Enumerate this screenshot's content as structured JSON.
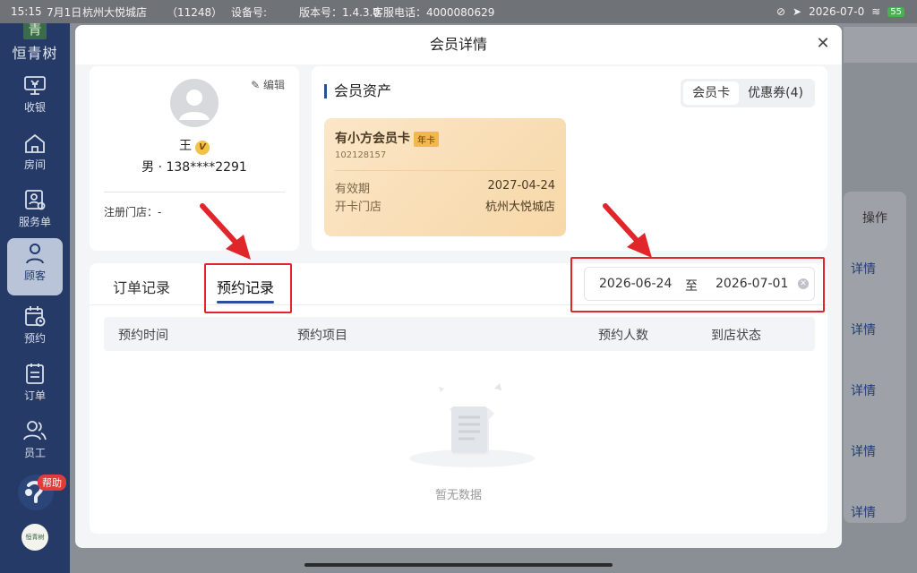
{
  "status_bar": {
    "time": "15:15",
    "date": "7月1日",
    "store": "杭州大悦城店",
    "store_id": "（11248）",
    "device": "设备号:",
    "version": "版本号：1.4.3.0",
    "phone": "客服电话：4000080629",
    "datetime_right": "2026-07-0",
    "battery": "55"
  },
  "sidebar": {
    "logo_mark": "青",
    "logo_name": "恒青树",
    "items": [
      {
        "label": "收银",
        "icon": "cashier-icon"
      },
      {
        "label": "房间",
        "icon": "home-icon"
      },
      {
        "label": "服务单",
        "icon": "service-order-icon"
      },
      {
        "label": "顾客",
        "icon": "customer-icon"
      },
      {
        "label": "预约",
        "icon": "calendar-icon"
      },
      {
        "label": "订单",
        "icon": "order-icon"
      },
      {
        "label": "员工",
        "icon": "staff-icon"
      }
    ],
    "help_label": "帮助",
    "app_label": "恒青树"
  },
  "background": {
    "column_header": "操作",
    "row_links": [
      "详情",
      "详情",
      "详情",
      "详情",
      "详情"
    ]
  },
  "modal": {
    "title": "会员详情",
    "profile": {
      "edit_label": "编辑",
      "name": "王",
      "vip_badge": "V",
      "info": "男 · 138****2291",
      "store_label": "注册门店：-"
    },
    "assets": {
      "title": "会员资产",
      "tabs": [
        "会员卡",
        "优惠券(4)"
      ],
      "active_tab": "会员卡",
      "card": {
        "name": "有小方会员卡",
        "tag": "年卡",
        "number": "102128157",
        "validity_label": "有效期",
        "validity_value": "2027-04-24",
        "store_label": "开卡门店",
        "store_value": "杭州大悦城店"
      }
    },
    "records": {
      "tabs": [
        "订单记录",
        "预约记录"
      ],
      "active_tab": "预约记录",
      "date_start": "2026-06-24",
      "date_sep": "至",
      "date_end": "2026-07-01",
      "columns": [
        "预约时间",
        "预约项目",
        "预约人数",
        "到店状态"
      ],
      "empty_text": "暂无数据"
    }
  },
  "colors": {
    "sidebar_bg": "#253a66",
    "accent": "#2a4f9a",
    "annotation_red": "#e0262b",
    "card_gold": "#f7d8a8"
  }
}
